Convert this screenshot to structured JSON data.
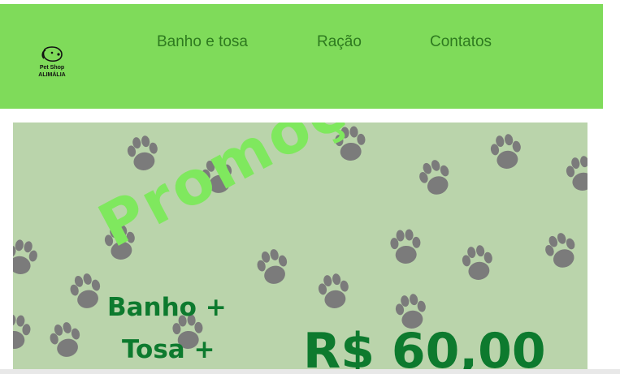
{
  "header": {
    "logo": {
      "line1": "Pet Shop",
      "line2": "ALIMÁLIA",
      "icon": "dog-icon"
    },
    "nav": [
      "Banho e tosa",
      "Ração",
      "Contatos"
    ]
  },
  "banner": {
    "promo_text": "Promoção",
    "line1": "Banho +",
    "line2": "Tosa +",
    "price": "R$ 60,00",
    "pattern_icon": "paw-print-icon"
  },
  "colors": {
    "header_bg": "#7fdb5a",
    "nav_text": "#2e7a1f",
    "banner_bg": "#bad4ab",
    "paw": "#7b7b7b",
    "promo": "#7fe85e",
    "offer_text": "#0d7a2e"
  }
}
